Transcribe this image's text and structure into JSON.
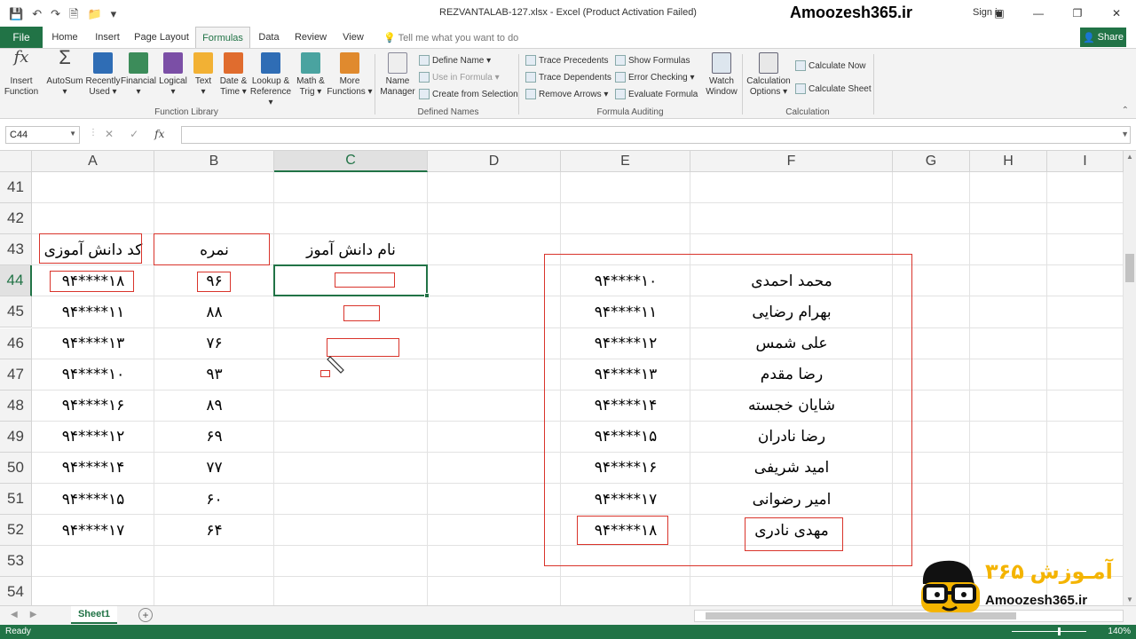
{
  "titlebar": {
    "doc_title": "REZVANTALAB-127.xlsx - Excel (Product Activation Failed)",
    "site_title": "Amoozesh365.ir",
    "signin": "Sign in",
    "minimize": "—",
    "restore": "❐",
    "close": "✕"
  },
  "tabs": {
    "file": "File",
    "items": [
      "Home",
      "Insert",
      "Page Layout",
      "Formulas",
      "Data",
      "Review",
      "View"
    ],
    "active": "Formulas",
    "tell_me": "Tell me what you want to do",
    "share": "Share"
  },
  "ribbon": {
    "insert_function": [
      "Insert",
      "Function"
    ],
    "autosum": [
      "AutoSum",
      "▾"
    ],
    "recently_used": [
      "Recently",
      "Used ▾"
    ],
    "financial": [
      "Financial",
      "▾"
    ],
    "logical": [
      "Logical",
      "▾"
    ],
    "text": [
      "Text",
      "▾"
    ],
    "date_time": [
      "Date &",
      "Time ▾"
    ],
    "lookup_reference": [
      "Lookup &",
      "Reference ▾"
    ],
    "math_trig": [
      "Math &",
      "Trig ▾"
    ],
    "more_functions": [
      "More",
      "Functions ▾"
    ],
    "function_library": "Function Library",
    "name_manager": [
      "Name",
      "Manager"
    ],
    "define_name": "Define Name ▾",
    "use_in_formula": "Use in Formula ▾",
    "create_from_selection": "Create from Selection",
    "defined_names": "Defined Names",
    "trace_precedents": "Trace Precedents",
    "trace_dependents": "Trace Dependents",
    "remove_arrows": "Remove Arrows ▾",
    "show_formulas": "Show Formulas",
    "error_checking": "Error Checking ▾",
    "evaluate_formula": "Evaluate Formula",
    "formula_auditing": "Formula Auditing",
    "watch_window": [
      "Watch",
      "Window"
    ],
    "calculation_options": [
      "Calculation",
      "Options ▾"
    ],
    "calculate_now": "Calculate Now",
    "calculate_sheet": "Calculate Sheet",
    "calculation": "Calculation"
  },
  "formula_bar": {
    "name_box": "C44",
    "cancel": "✕",
    "enter": "✓",
    "fx": "fx",
    "value": ""
  },
  "grid": {
    "columns": [
      "A",
      "B",
      "C",
      "D",
      "E",
      "F",
      "G",
      "H",
      "I"
    ],
    "selected_column": "C",
    "rows": [
      "41",
      "42",
      "43",
      "44",
      "45",
      "46",
      "47",
      "48",
      "49",
      "50",
      "51",
      "52",
      "53",
      "54"
    ],
    "selected_row": "44",
    "headers": {
      "student_code": "کد دانش آموزی",
      "grade": "نمره",
      "student_name": "نام دانش آموز"
    },
    "left_table": [
      {
        "code": "۹۴****۱۸",
        "grade": "۹۶"
      },
      {
        "code": "۹۴****۱۱",
        "grade": "۸۸"
      },
      {
        "code": "۹۴****۱۳",
        "grade": "۷۶"
      },
      {
        "code": "۹۴****۱۰",
        "grade": "۹۳"
      },
      {
        "code": "۹۴****۱۶",
        "grade": "۸۹"
      },
      {
        "code": "۹۴****۱۲",
        "grade": "۶۹"
      },
      {
        "code": "۹۴****۱۴",
        "grade": "۷۷"
      },
      {
        "code": "۹۴****۱۵",
        "grade": "۶۰"
      },
      {
        "code": "۹۴****۱۷",
        "grade": "۶۴"
      }
    ],
    "right_table": [
      {
        "code": "۹۴****۱۰",
        "name": "محمد احمدی"
      },
      {
        "code": "۹۴****۱۱",
        "name": "بهرام رضایی"
      },
      {
        "code": "۹۴****۱۲",
        "name": "علی شمس"
      },
      {
        "code": "۹۴****۱۳",
        "name": "رضا مقدم"
      },
      {
        "code": "۹۴****۱۴",
        "name": "شایان خجسته"
      },
      {
        "code": "۹۴****۱۵",
        "name": "رضا نادران"
      },
      {
        "code": "۹۴****۱۶",
        "name": "امید شریفی"
      },
      {
        "code": "۹۴****۱۷",
        "name": "امیر رضوانی"
      },
      {
        "code": "۹۴****۱۸",
        "name": "مهدی نادری"
      }
    ]
  },
  "sheets": {
    "active": "Sheet1",
    "add": "+"
  },
  "status": {
    "ready": "Ready",
    "zoom": "140%"
  },
  "logo": {
    "brand_fa": "آمـوزش ۳۶۵",
    "brand_en": "Amoozesh365.ir"
  },
  "colors": {
    "excel_green": "#217346",
    "annotation_red": "#d9342b",
    "logo_yellow": "#f4b400"
  }
}
